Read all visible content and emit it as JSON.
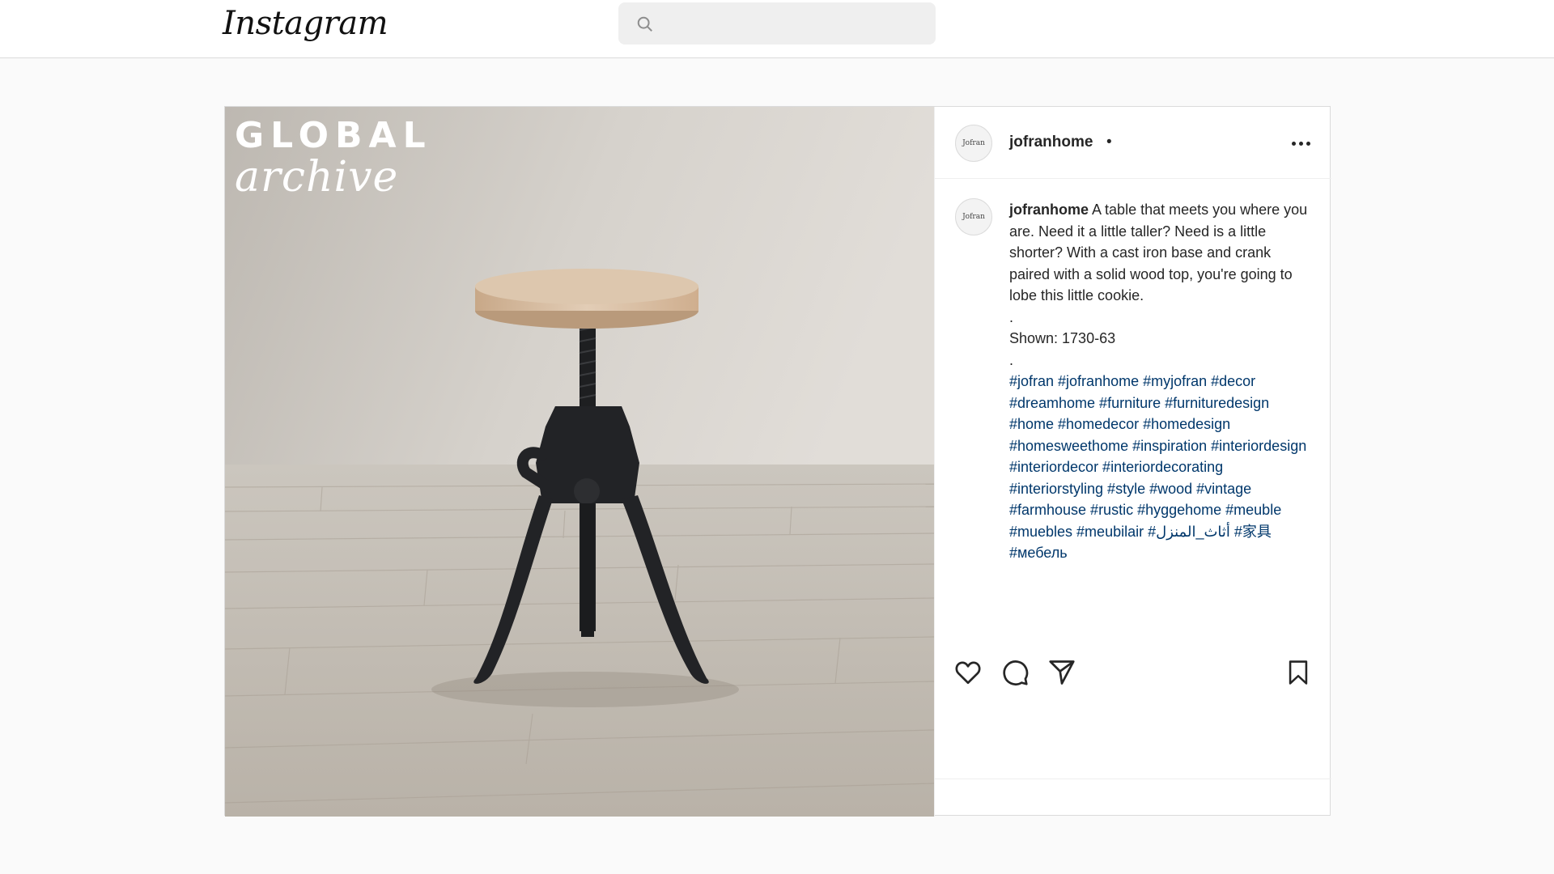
{
  "header": {
    "logo": "Instagram",
    "search_placeholder": "",
    "search_icon": "search-icon"
  },
  "post": {
    "image_overlay": {
      "line1": "GLOBAL",
      "line2": "archive"
    },
    "username": "jofranhome",
    "separator": "•",
    "avatar_text": "Jofran",
    "more_icon": "more-horizontal-icon",
    "caption": {
      "username": "jofranhome",
      "text": "A table that meets you where you are. Need it a little taller? Need is a little shorter? With a cast iron base and crank paired with a solid wood top, you're going to lobe this little cookie.",
      "dot1": ".",
      "shown": "Shown: 1730-63",
      "dot2": ".",
      "hashtags": "#jofran #jofranhome #myjofran #decor #dreamhome #furniture #furnituredesign #home #homedecor #homedesign #homesweethome #inspiration #interiordesign #interiordecor #interiordecorating #interiorstyling #style #wood #vintage #farmhouse #rustic #hyggehome #meuble #muebles #meubilair #أثاث_المنزل #家具 #мебель"
    },
    "actions": {
      "like_icon": "heart-icon",
      "comment_icon": "comment-icon",
      "share_icon": "send-icon",
      "save_icon": "bookmark-icon"
    }
  },
  "colors": {
    "page_bg": "#fafafa",
    "hashtag": "#00376b",
    "border": "#dbdbdb"
  }
}
